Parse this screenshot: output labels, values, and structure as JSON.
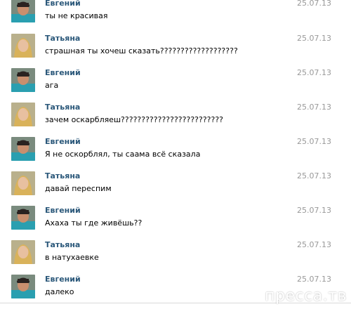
{
  "conversation": {
    "messages": [
      {
        "author": "Евгений",
        "avatar_icon": "male-avatar-icon",
        "date": "25.07.13",
        "text": "ты не красивая"
      },
      {
        "author": "Татьяна",
        "avatar_icon": "female-avatar-icon",
        "date": "25.07.13",
        "text": "страшная ты хочеш сказать???????????????????"
      },
      {
        "author": "Евгений",
        "avatar_icon": "male-avatar-icon",
        "date": "25.07.13",
        "text": "ага"
      },
      {
        "author": "Татьяна",
        "avatar_icon": "female-avatar-icon",
        "date": "25.07.13",
        "text": "зачем оскарбляеш?????????????????????????"
      },
      {
        "author": "Евгений",
        "avatar_icon": "male-avatar-icon",
        "date": "25.07.13",
        "text": "Я не оскорблял, ты саама всё сказала"
      },
      {
        "author": "Татьяна",
        "avatar_icon": "female-avatar-icon",
        "date": "25.07.13",
        "text": "давай переспим"
      },
      {
        "author": "Евгений",
        "avatar_icon": "male-avatar-icon",
        "date": "25.07.13",
        "text": "Ахаха ты где живёшь??"
      },
      {
        "author": "Татьяна",
        "avatar_icon": "female-avatar-icon",
        "date": "25.07.13",
        "text": "в натухаевке"
      },
      {
        "author": "Евгений",
        "avatar_icon": "male-avatar-icon",
        "date": "25.07.13",
        "text": "далеко"
      }
    ]
  },
  "watermark": {
    "text": "пресса.тв"
  },
  "colors": {
    "author_name": "#2b587a",
    "date": "#999999",
    "message_text": "#000000"
  }
}
